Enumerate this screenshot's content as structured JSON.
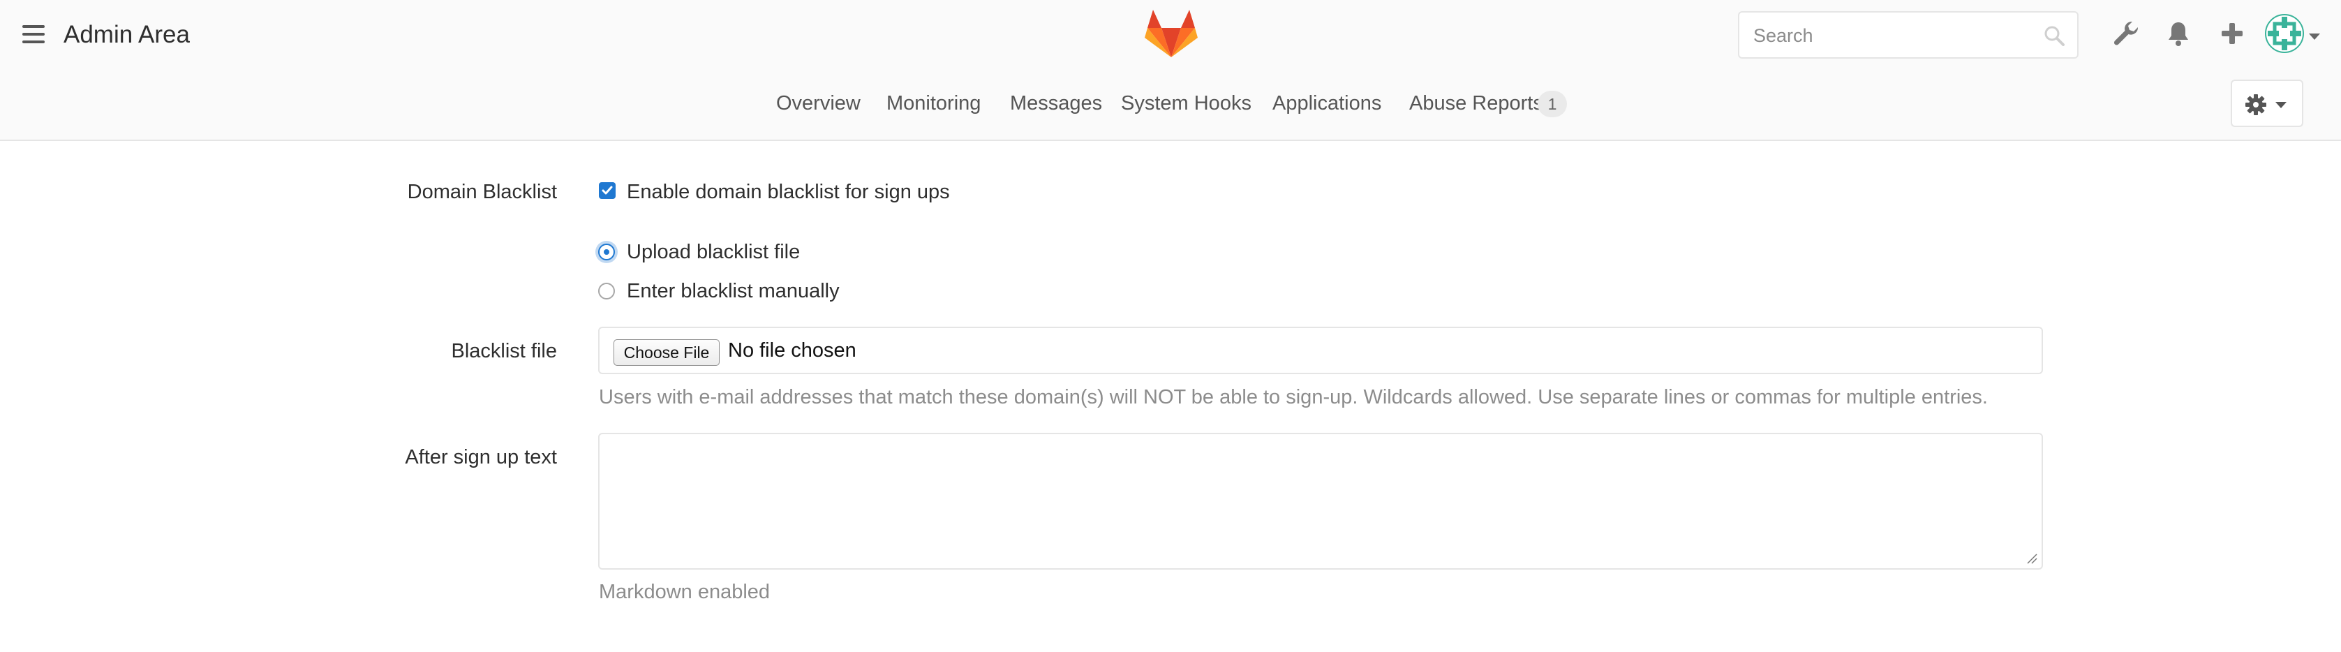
{
  "header": {
    "title": "Admin Area",
    "search_placeholder": "Search",
    "icons": [
      "menu-icon",
      "gitlab-logo",
      "search-icon",
      "wrench-icon",
      "bell-icon",
      "plus-icon",
      "avatar",
      "chevron-down-icon"
    ]
  },
  "nav": {
    "items": [
      "Overview",
      "Monitoring",
      "Messages",
      "System Hooks",
      "Applications",
      "Abuse Reports"
    ],
    "abuse_reports_count": "1"
  },
  "form": {
    "domain_blacklist_label": "Domain Blacklist",
    "enable_checkbox_label": "Enable domain blacklist for sign ups",
    "enable_checked": true,
    "upload_option_label": "Upload blacklist file",
    "manual_option_label": "Enter blacklist manually",
    "selected_option": "Upload blacklist file",
    "blacklist_file_label": "Blacklist file",
    "choose_file_label": "Choose File",
    "no_file_text": "No file chosen",
    "blacklist_help": "Users with e-mail addresses that match these domain(s) will NOT be able to sign-up. Wildcards allowed. Use separate lines or commas for multiple entries.",
    "after_signup_label": "After sign up text",
    "after_signup_value": "",
    "markdown_help": "Markdown enabled"
  },
  "colors": {
    "accent": "#1f78d1",
    "header_bg": "#fafafa",
    "border": "#e5e5e5",
    "muted_text": "#8c8c8c"
  }
}
